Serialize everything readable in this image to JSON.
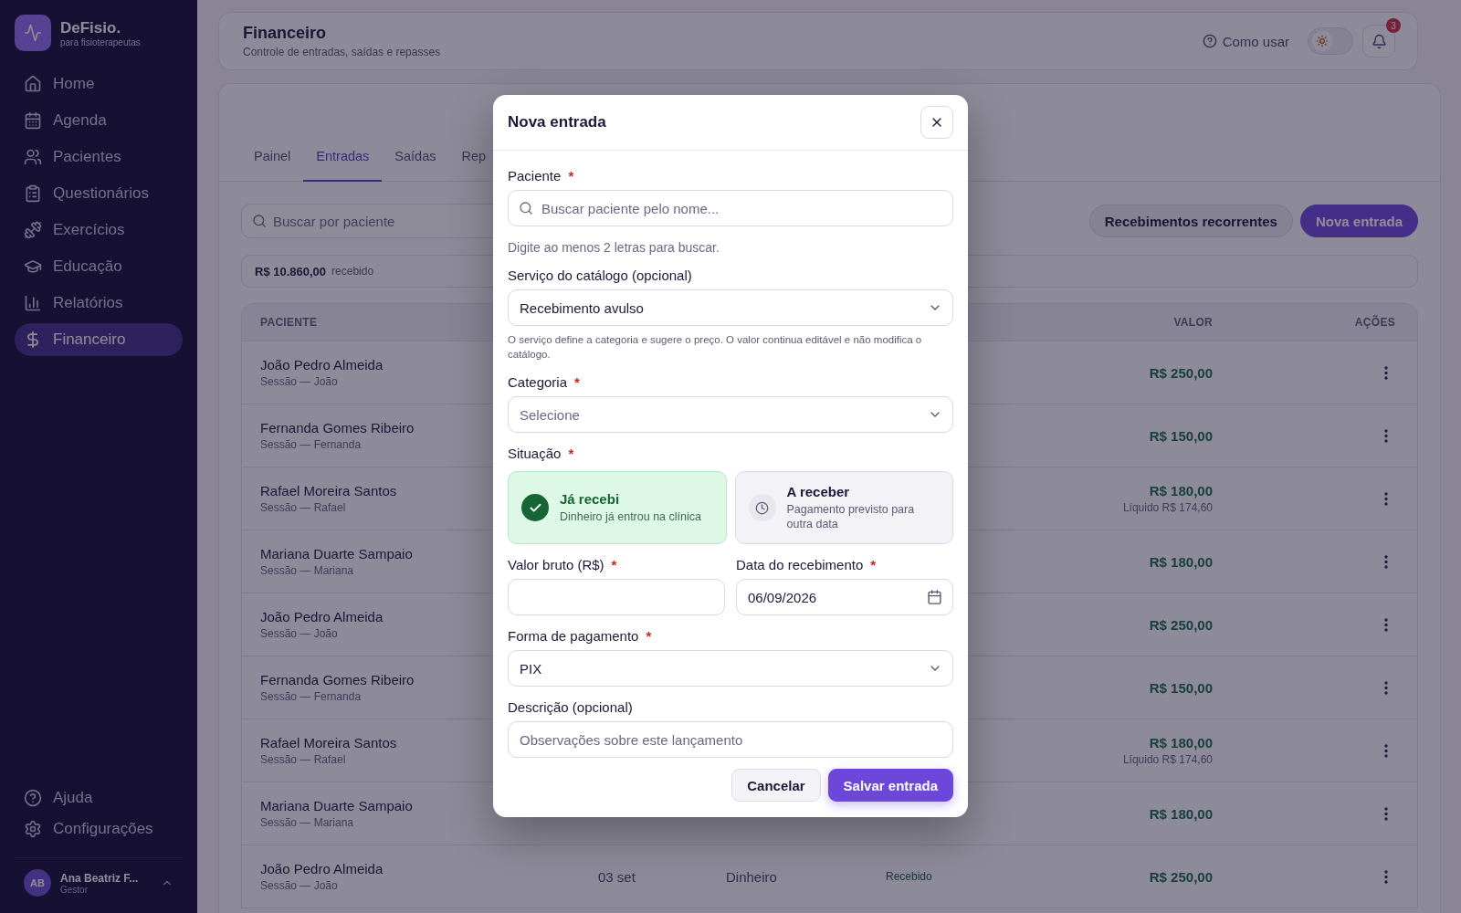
{
  "sidebar": {
    "brand": {
      "name": "DeFisio.",
      "tagline": "para fisioterapeutas"
    },
    "items": [
      {
        "label": "Home",
        "selected": false
      },
      {
        "label": "Agenda",
        "selected": false
      },
      {
        "label": "Pacientes",
        "selected": false
      },
      {
        "label": "Questionários",
        "selected": false
      },
      {
        "label": "Exercícios",
        "selected": false
      },
      {
        "label": "Educação",
        "selected": false
      },
      {
        "label": "Relatórios",
        "selected": false
      },
      {
        "label": "Financeiro",
        "selected": true
      }
    ],
    "footer_items": [
      {
        "label": "Ajuda"
      },
      {
        "label": "Configurações"
      }
    ],
    "user": {
      "initials": "AB",
      "name": "Ana Beatriz F...",
      "role": "Gestor"
    }
  },
  "header": {
    "title": "Financeiro",
    "subtitle": "Controle de entradas, saídas e repasses",
    "help": "Como usar",
    "dark_mode": false,
    "notifications": "3"
  },
  "tabs": [
    {
      "label": "Painel",
      "selected": false
    },
    {
      "label": "Entradas",
      "selected": true
    },
    {
      "label": "Saídas",
      "selected": false
    },
    {
      "label": "Rep",
      "selected": false
    }
  ],
  "toolbar": {
    "search": {
      "placeholder": "Buscar por paciente"
    },
    "buttons": [
      {
        "label": "Recebimentos recorrentes",
        "kind": "secondary"
      },
      {
        "label": "Nova entrada",
        "kind": "primary"
      }
    ]
  },
  "summary": {
    "amount": "R$ 10.860,00",
    "label": "recebido"
  },
  "table": {
    "columns": [
      "PACIENTE",
      "VALOR",
      "AÇÕES"
    ],
    "rows": [
      {
        "patient": "João Pedro Almeida",
        "description": "Sessão — João",
        "value": "R$ 250,00"
      },
      {
        "patient": "Fernanda Gomes Ribeiro",
        "description": "Sessão — Fernanda",
        "value": "R$ 150,00"
      },
      {
        "patient": "Rafael Moreira Santos",
        "description": "Sessão — Rafael",
        "value": "R$ 180,00",
        "net": "Líquido R$ 174,60"
      },
      {
        "patient": "Mariana Duarte Sampaio",
        "description": "Sessão — Mariana",
        "value": "R$ 180,00"
      },
      {
        "patient": "João Pedro Almeida",
        "description": "Sessão — João",
        "value": "R$ 250,00"
      },
      {
        "patient": "Fernanda Gomes Ribeiro",
        "description": "Sessão — Fernanda",
        "value": "R$ 150,00"
      },
      {
        "patient": "Rafael Moreira Santos",
        "description": "Sessão — Rafael",
        "value": "R$ 180,00",
        "net": "Líquido R$ 174,60"
      },
      {
        "patient": "Mariana Duarte Sampaio",
        "description": "Sessão — Mariana",
        "value": "R$ 180,00"
      },
      {
        "patient": "João Pedro Almeida",
        "description": "Sessão — João",
        "date": "03 set",
        "method": "Dinheiro",
        "status": "Recebido",
        "value": "R$ 250,00"
      }
    ]
  },
  "modal": {
    "title": "Nova entrada",
    "fields": [
      {
        "kind": "search",
        "label": "Paciente",
        "required": "*",
        "placeholder": "Buscar paciente pelo nome...",
        "hint": "Digite ao menos 2 letras para buscar."
      },
      {
        "kind": "select",
        "label": "Serviço do catálogo (opcional)",
        "value": "Recebimento avulso",
        "note": "O serviço define a categoria e sugere o preço. O valor continua editável e não modifica o catálogo."
      },
      {
        "kind": "select",
        "label": "Categoria",
        "required": "*",
        "placeholder": "Selecione"
      },
      {
        "kind": "choice",
        "label": "Situação",
        "required": "*",
        "options": [
          {
            "title": "Já recebi",
            "description": "Dinheiro já entrou na clínica",
            "selected": true
          },
          {
            "title": "A receber",
            "description": "Pagamento previsto para outra data",
            "selected": false
          }
        ]
      },
      {
        "kind": "pair",
        "items": [
          {
            "kind": "text",
            "label": "Valor bruto (R$)",
            "required": "*"
          },
          {
            "kind": "date",
            "label": "Data do recebimento",
            "required": "*",
            "value": "06/09/2026"
          }
        ]
      },
      {
        "kind": "select",
        "label": "Forma de pagamento",
        "required": "*",
        "value": "PIX"
      },
      {
        "kind": "text",
        "label": "Descrição (opcional)",
        "placeholder": "Observações sobre este lançamento"
      }
    ],
    "buttons": [
      {
        "label": "Cancelar",
        "kind": "secondary"
      },
      {
        "label": "Salvar entrada",
        "kind": "primary"
      }
    ]
  }
}
